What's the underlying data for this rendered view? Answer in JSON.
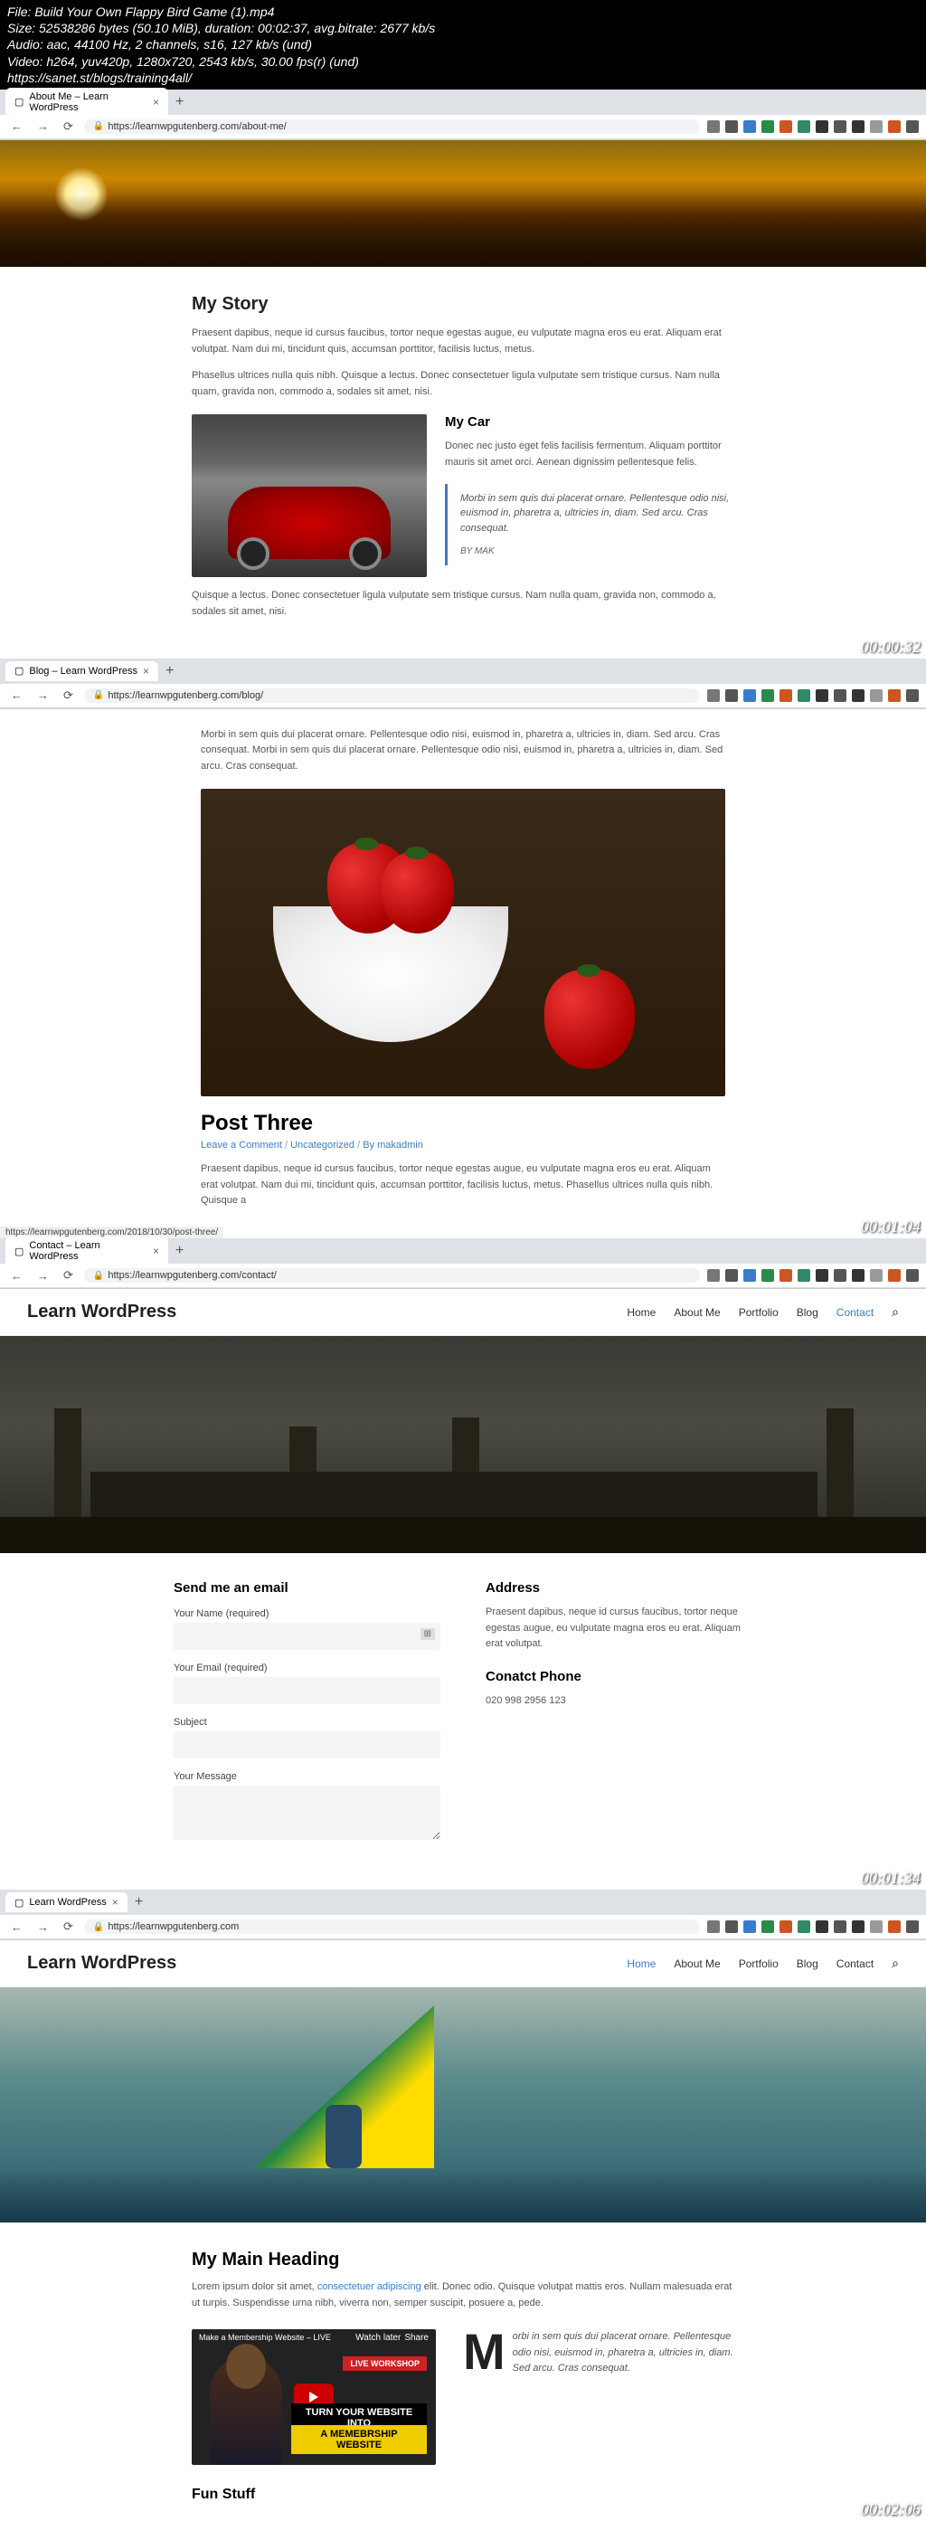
{
  "video_info": {
    "file": "File: Build Your Own Flappy Bird Game (1).mp4",
    "size": "Size: 52538286 bytes (50.10 MiB), duration: 00:02:37, avg.bitrate: 2677 kb/s",
    "audio": "Audio: aac, 44100 Hz, 2 channels, s16, 127 kb/s (und)",
    "video": "Video: h264, yuv420p, 1280x720, 2543 kb/s, 30.00 fps(r) (und)",
    "url": "https://sanet.st/blogs/training4all/"
  },
  "ext_colors": [
    "#777",
    "#555",
    "#3a7cc9",
    "#2a8a4a",
    "#cc5522",
    "#338866",
    "#333",
    "#555",
    "#333",
    "#999",
    "#cc5522",
    "#555"
  ],
  "s1": {
    "tab": "About Me – Learn WordPress",
    "url": "https://learnwpgutenberg.com/about-me/",
    "ts": "00:00:32",
    "h1": "My Story",
    "p1": "Praesent dapibus, neque id cursus faucibus, tortor neque egestas augue, eu vulputate magna eros eu erat. Aliquam erat volutpat. Nam dui mi, tincidunt quis, accumsan porttitor, facilisis luctus, metus.",
    "p2": "Phasellus ultrices nulla quis nibh. Quisque a lectus. Donec consectetuer ligula vulputate sem tristique cursus. Nam nulla quam, gravida non, commodo a, sodales sit amet, nisi.",
    "h2": "My Car",
    "p3": "Donec nec justo eget felis facilisis fermentum. Aliquam porttitor mauris sit amet orci. Aenean dignissim pellentesque felis.",
    "quote": "Morbi in sem quis dui placerat ornare. Pellentesque odio nisi, euismod in, pharetra a, ultricies in, diam. Sed arcu. Cras consequat.",
    "author": "BY MAK",
    "p4": "Quisque a lectus. Donec consectetuer ligula vulputate sem tristique cursus. Nam nulla quam, gravida non, commodo a, sodales sit amet, nisi."
  },
  "s2": {
    "tab": "Blog – Learn WordPress",
    "url": "https://learnwpgutenberg.com/blog/",
    "ts": "00:01:04",
    "p1": "Morbi in sem quis dui placerat ornare. Pellentesque odio nisi, euismod in, pharetra a, ultricies in, diam. Sed arcu. Cras consequat. Morbi in sem quis dui placerat ornare. Pellentesque odio nisi, euismod in, pharetra a, ultricies in, diam. Sed arcu. Cras consequat.",
    "title": "Post Three",
    "meta_comment": "Leave a Comment",
    "meta_cat": "Uncategorized",
    "meta_by": "By",
    "meta_author": "makadmin",
    "p2": "Praesent dapibus, neque id cursus faucibus, tortor neque egestas augue, eu vulputate magna eros eu erat. Aliquam erat volutpat. Nam dui mi, tincidunt quis, accumsan porttitor, facilisis luctus, metus. Phasellus ultrices nulla quis nibh. Quisque a",
    "status": "https://learnwpgutenberg.com/2018/10/30/post-three/"
  },
  "s3": {
    "tab": "Contact – Learn WordPress",
    "url": "https://learnwpgutenberg.com/contact/",
    "ts": "00:01:34",
    "logo": "Learn WordPress",
    "nav": {
      "home": "Home",
      "about": "About Me",
      "portfolio": "Portfolio",
      "blog": "Blog",
      "contact": "Contact"
    },
    "form_h": "Send me an email",
    "lbl_name": "Your Name (required)",
    "lbl_email": "Your Email (required)",
    "lbl_subject": "Subject",
    "lbl_message": "Your Message",
    "badge": "⊞",
    "addr_h": "Address",
    "addr_text": "Praesent dapibus, neque id cursus faucibus, tortor neque egestas augue, eu vulputate magna eros eu erat. Aliquam erat volutpat.",
    "phone_h": "Conatct Phone",
    "phone": "020 998 2956 123"
  },
  "s4": {
    "tab": "Learn WordPress",
    "url": "https://learnwpgutenberg.com",
    "ts": "00:02:06",
    "logo": "Learn WordPress",
    "nav": {
      "home": "Home",
      "about": "About Me",
      "portfolio": "Portfolio",
      "blog": "Blog",
      "contact": "Contact"
    },
    "h1": "My Main Heading",
    "p1a": "Lorem ipsum dolor sit amet, ",
    "p1link": "consectetuer adipiscing",
    "p1b": " elit. Donec odio. Quisque volutpat mattis eros. Nullam malesuada erat ut turpis. Suspendisse urna nibh, viverra non, semper suscipit, posuere a, pede.",
    "vt_title": "Make a Membership Website – LIVE",
    "vt_later": "Watch later",
    "vt_share": "Share",
    "vt_live": "LIVE WORKSHOP",
    "vt_b1": "TURN YOUR WEBSITE INTO",
    "vt_b2": "A MEMEBRSHIP WEBSITE",
    "dropcap": "M",
    "drop_text": "orbi in sem quis dui placerat ornare. Pellentesque odio nisi, euismod in, pharetra a, ultricies in, diam. Sed arcu. Cras consequat.",
    "fun_h": "Fun Stuff"
  }
}
